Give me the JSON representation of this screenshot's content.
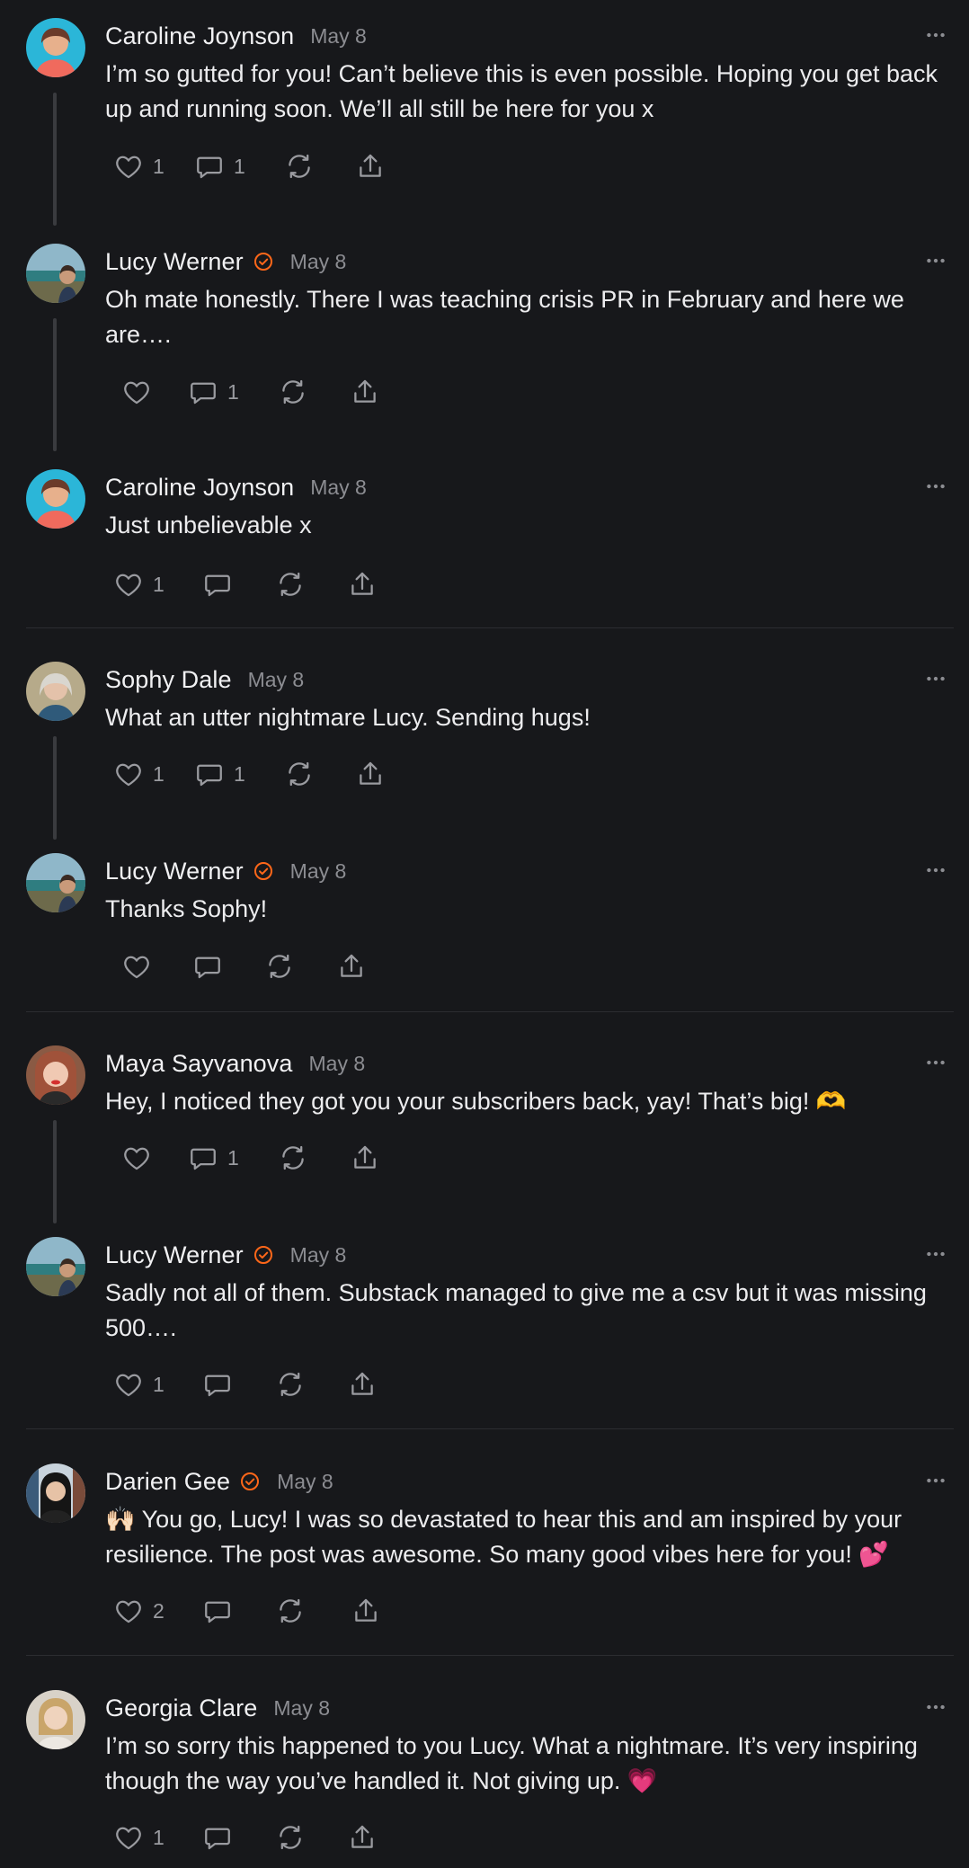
{
  "colors": {
    "background": "#17181b",
    "verified": "#ff6719",
    "muted": "#8c8d92"
  },
  "comments": [
    {
      "name": "Caroline Joynson",
      "date": "May 8",
      "text": "I’m so gutted for you! Can’t believe this is even possible. Hoping you get back up and running soon. We’ll all still be here for you x",
      "likes": "1",
      "replies": "1",
      "avatar": "avatar-caroline"
    },
    {
      "name": "Lucy Werner",
      "date": "May 8",
      "text": "Oh mate honestly. There I was teaching crisis PR in February and here we are….",
      "likes": "",
      "replies": "1",
      "avatar": "avatar-lucy",
      "verified": true
    },
    {
      "name": "Caroline Joynson",
      "date": "May 8",
      "text": "Just unbelievable x",
      "likes": "1",
      "replies": "",
      "avatar": "avatar-caroline"
    },
    {
      "name": "Sophy Dale",
      "date": "May 8",
      "text": "What an utter nightmare Lucy. Sending hugs!",
      "likes": "1",
      "replies": "1",
      "avatar": "avatar-sophy"
    },
    {
      "name": "Lucy Werner",
      "date": "May 8",
      "text": "Thanks Sophy!",
      "likes": "",
      "replies": "",
      "avatar": "avatar-lucy",
      "verified": true
    },
    {
      "name": "Maya Sayvanova",
      "date": "May 8",
      "text": "Hey, I noticed they got you your subscribers back, yay! That’s big! 🫶",
      "likes": "",
      "replies": "1",
      "avatar": "avatar-maya"
    },
    {
      "name": "Lucy Werner",
      "date": "May 8",
      "text": "Sadly not all of them. Substack managed to give me a csv but it was missing 500….",
      "likes": "1",
      "replies": "",
      "avatar": "avatar-lucy",
      "verified": true
    },
    {
      "name": "Darien Gee",
      "date": "May 8",
      "text": "🙌🏻 You go, Lucy! I was so devastated to hear this and am inspired by your resilience. The post was awesome. So many good vibes here for you! 💕",
      "likes": "2",
      "replies": "",
      "avatar": "avatar-darien",
      "verified": true
    },
    {
      "name": "Georgia Clare",
      "date": "May 8",
      "text": "I’m so sorry this happened to you Lucy. What a nightmare. It’s very inspiring though the way you’ve handled it. Not giving up. 💗",
      "likes": "1",
      "replies": "",
      "avatar": "avatar-georgia"
    }
  ]
}
